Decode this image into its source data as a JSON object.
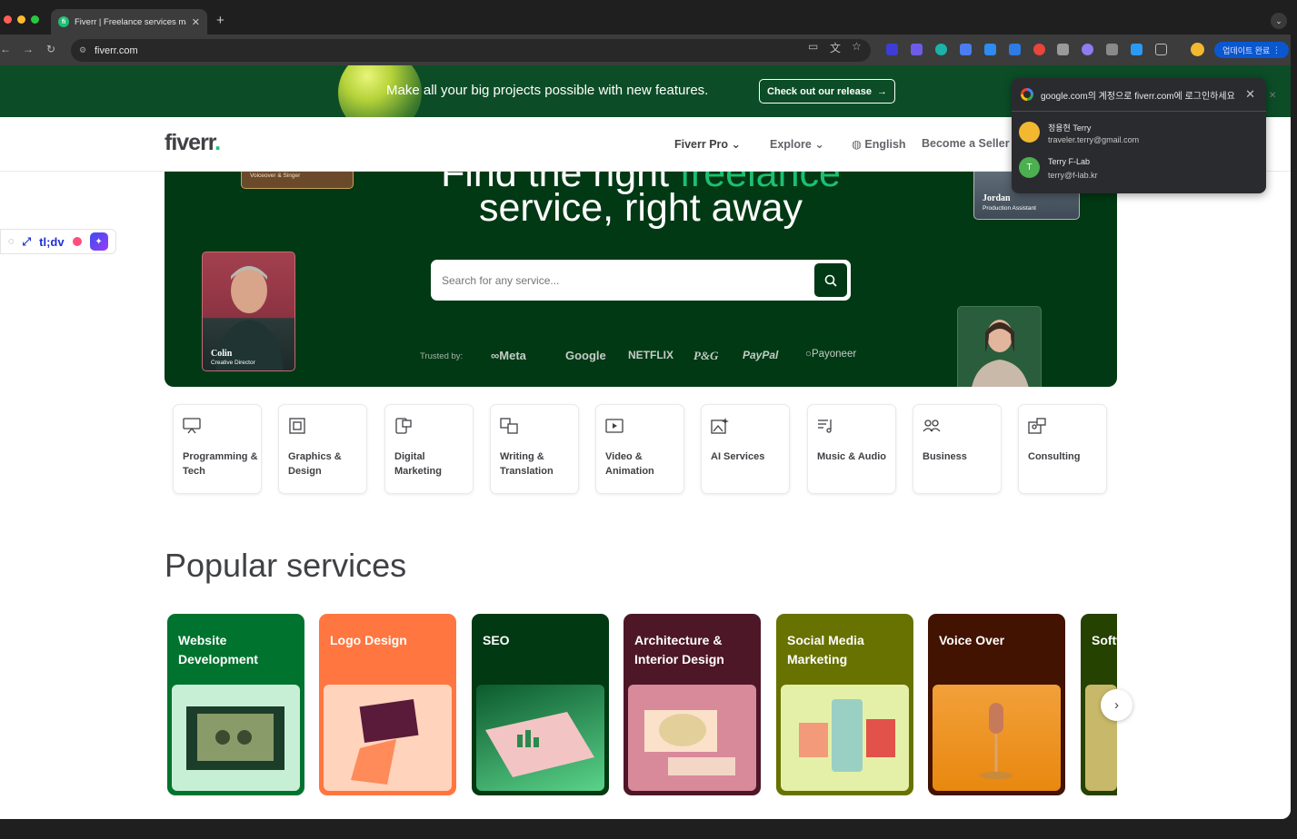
{
  "browser": {
    "tab_title": "Fiverr | Freelance services ma",
    "url": "fiverr.com",
    "update_button": "업데이트 완료"
  },
  "promo": {
    "message": "Make all your big projects possible with new features.",
    "cta": "Check out our release"
  },
  "header": {
    "logo": "fiverr",
    "nav": [
      "Fiverr Pro",
      "Explore",
      "English",
      "Become a Seller"
    ]
  },
  "hero": {
    "headline_top": "Find the right ",
    "headline_top_green": "freelance",
    "headline": "service, right away",
    "search_placeholder": "Search for any service...",
    "trusted_label": "Trusted by:",
    "brands": [
      "Meta",
      "Google",
      "NETFLIX",
      "P&G",
      "PayPal",
      "Payoneer"
    ],
    "portraits": [
      {
        "name": "Colin",
        "role": "Creative Director"
      },
      {
        "name": "Jordan",
        "role": "Production Assistant"
      },
      {
        "name": "",
        "role": "Voiceover & Singer"
      }
    ]
  },
  "tldv": {
    "label": "tl;dv"
  },
  "google_popup": {
    "title": "google.com의 계정으로 fiverr.com에 로그인하세요",
    "accounts": [
      {
        "name": "정용현 Terry",
        "email": "traveler.terry@gmail.com",
        "initial": "",
        "color": "#f1b830"
      },
      {
        "name": "Terry F-Lab",
        "email": "terry@f-lab.kr",
        "initial": "T",
        "color": "#4caf50"
      }
    ]
  },
  "categories": [
    {
      "label": "Programming & Tech",
      "icon": "monitor-icon"
    },
    {
      "label": "Graphics & Design",
      "icon": "pen-tool-icon"
    },
    {
      "label": "Digital Marketing",
      "icon": "phone-chart-icon"
    },
    {
      "label": "Writing & Translation",
      "icon": "translate-icon"
    },
    {
      "label": "Video & Animation",
      "icon": "video-play-icon"
    },
    {
      "label": "AI Services",
      "icon": "ai-image-icon"
    },
    {
      "label": "Music & Audio",
      "icon": "music-icon"
    },
    {
      "label": "Business",
      "icon": "people-icon"
    },
    {
      "label": "Consulting",
      "icon": "consult-icon"
    }
  ],
  "popular": {
    "title": "Popular services",
    "cards": [
      {
        "title": "Website Development",
        "bg": "#00732e",
        "img_bg": "#c7efd6"
      },
      {
        "title": "Logo Design",
        "bg": "#ff7640",
        "img_bg": "#ffd3bc"
      },
      {
        "title": "SEO",
        "bg": "#003912",
        "img_bg": "#2a8a4e"
      },
      {
        "title": "Architecture & Interior Design",
        "bg": "#4d1727",
        "img_bg": "#d88a9a"
      },
      {
        "title": "Social Media Marketing",
        "bg": "#687200",
        "img_bg": "#e4f0a8"
      },
      {
        "title": "Voice Over",
        "bg": "#421300",
        "img_bg": "#f2a03a"
      },
      {
        "title": "Software Development",
        "bg": "#254200",
        "img_bg": "#c7b86a"
      }
    ]
  }
}
